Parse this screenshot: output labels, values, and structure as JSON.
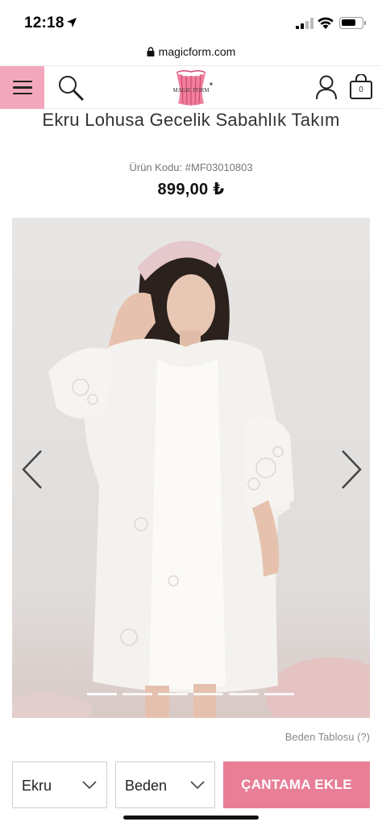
{
  "status_bar": {
    "time": "12:18",
    "battery_level": 0.75
  },
  "browser": {
    "url": "magicform.com"
  },
  "header": {
    "logo_text": "MAGIC FORM",
    "bag_count": "0",
    "brand_color": "#f2a7bd"
  },
  "product": {
    "title": "Ekru Lohusa Gecelik Sabahlık Takım",
    "code": "Ürün Kodu: #MF03010803",
    "price": "899,00 ₺"
  },
  "gallery": {
    "slide_count": 6,
    "active_slide": 1
  },
  "size_chart_link": "Beden Tablosu (?)",
  "controls": {
    "color_value": "Ekru",
    "size_value": "Beden",
    "add_to_cart": "ÇANTAMA EKLE",
    "button_color": "#e87f96"
  }
}
